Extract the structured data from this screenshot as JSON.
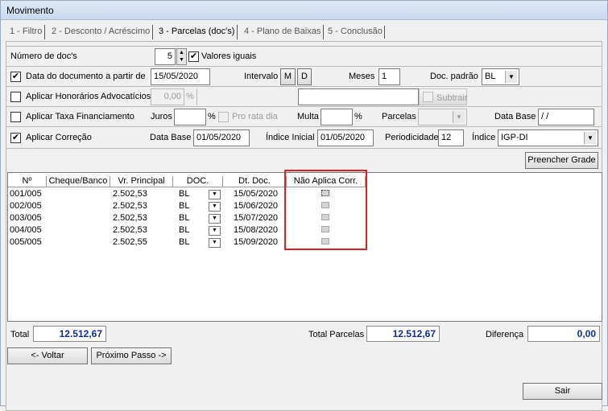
{
  "window": {
    "title": "Movimento"
  },
  "tabs": [
    {
      "label": "1 - Filtro"
    },
    {
      "label": "2 - Desconto / Acréscimo"
    },
    {
      "label": "3 - Parcelas (doc's)"
    },
    {
      "label": "4 - Plano de Baixas"
    },
    {
      "label": "5 - Conclusão"
    }
  ],
  "form": {
    "num_docs_label": "Número de doc's",
    "num_docs_value": "5",
    "valores_iguais_label": "Valores iguais",
    "data_doc_label": "Data do documento a partir de",
    "data_doc_value": "15/05/2020",
    "intervalo_label": "Intervalo",
    "intervalo_m": "M",
    "intervalo_d": "D",
    "meses_label": "Meses",
    "meses_value": "1",
    "doc_padrao_label": "Doc. padrão",
    "doc_padrao_value": "BL",
    "honorarios_label": "Aplicar Honorários Advocatícios",
    "honorarios_value": "0,00",
    "honorarios_pct": "%",
    "subtrair_label": "Subtrair",
    "taxa_label": "Aplicar Taxa Financiamento",
    "juros_label": "Juros",
    "juros_pct": "%",
    "pro_rata_label": "Pro rata dia",
    "multa_label": "Multa",
    "multa_pct": "%",
    "parcelas_label": "Parcelas",
    "data_base_label": "Data Base",
    "data_base_empty": " / /",
    "correcao_label": "Aplicar Correção",
    "data_base_corr_value": "01/05/2020",
    "indice_inicial_label": "Índice Inicial",
    "indice_inicial_value": "01/05/2020",
    "periodicidade_label": "Periodicidade",
    "periodicidade_value": "12",
    "indice_label": "Índice",
    "indice_value": "IGP-DI",
    "preencher_button": "Preencher Grade"
  },
  "grid": {
    "columns": [
      "Nº",
      "Cheque/Banco",
      "Vr. Principal",
      "DOC.",
      "Dt. Doc.",
      "Não Aplica Corr."
    ],
    "rows": [
      {
        "num": "001/005",
        "cheque": "",
        "valor": "2.502,53",
        "doc": "BL",
        "data": "15/05/2020"
      },
      {
        "num": "002/005",
        "cheque": "",
        "valor": "2.502,53",
        "doc": "BL",
        "data": "15/06/2020"
      },
      {
        "num": "003/005",
        "cheque": "",
        "valor": "2.502,53",
        "doc": "BL",
        "data": "15/07/2020"
      },
      {
        "num": "004/005",
        "cheque": "",
        "valor": "2.502,53",
        "doc": "BL",
        "data": "15/08/2020"
      },
      {
        "num": "005/005",
        "cheque": "",
        "valor": "2.502,55",
        "doc": "BL",
        "data": "15/09/2020"
      }
    ]
  },
  "totals": {
    "total_label": "Total",
    "total_value": "12.512,67",
    "total_parcelas_label": "Total Parcelas",
    "total_parcelas_value": "12.512,67",
    "diferenca_label": "Diferença",
    "diferenca_value": "0,00"
  },
  "nav": {
    "voltar": "<- Voltar",
    "proximo": "Próximo Passo ->",
    "sair": "Sair"
  },
  "colors": {
    "highlight": "#e0201c",
    "total_text": "#0a2aa8"
  }
}
